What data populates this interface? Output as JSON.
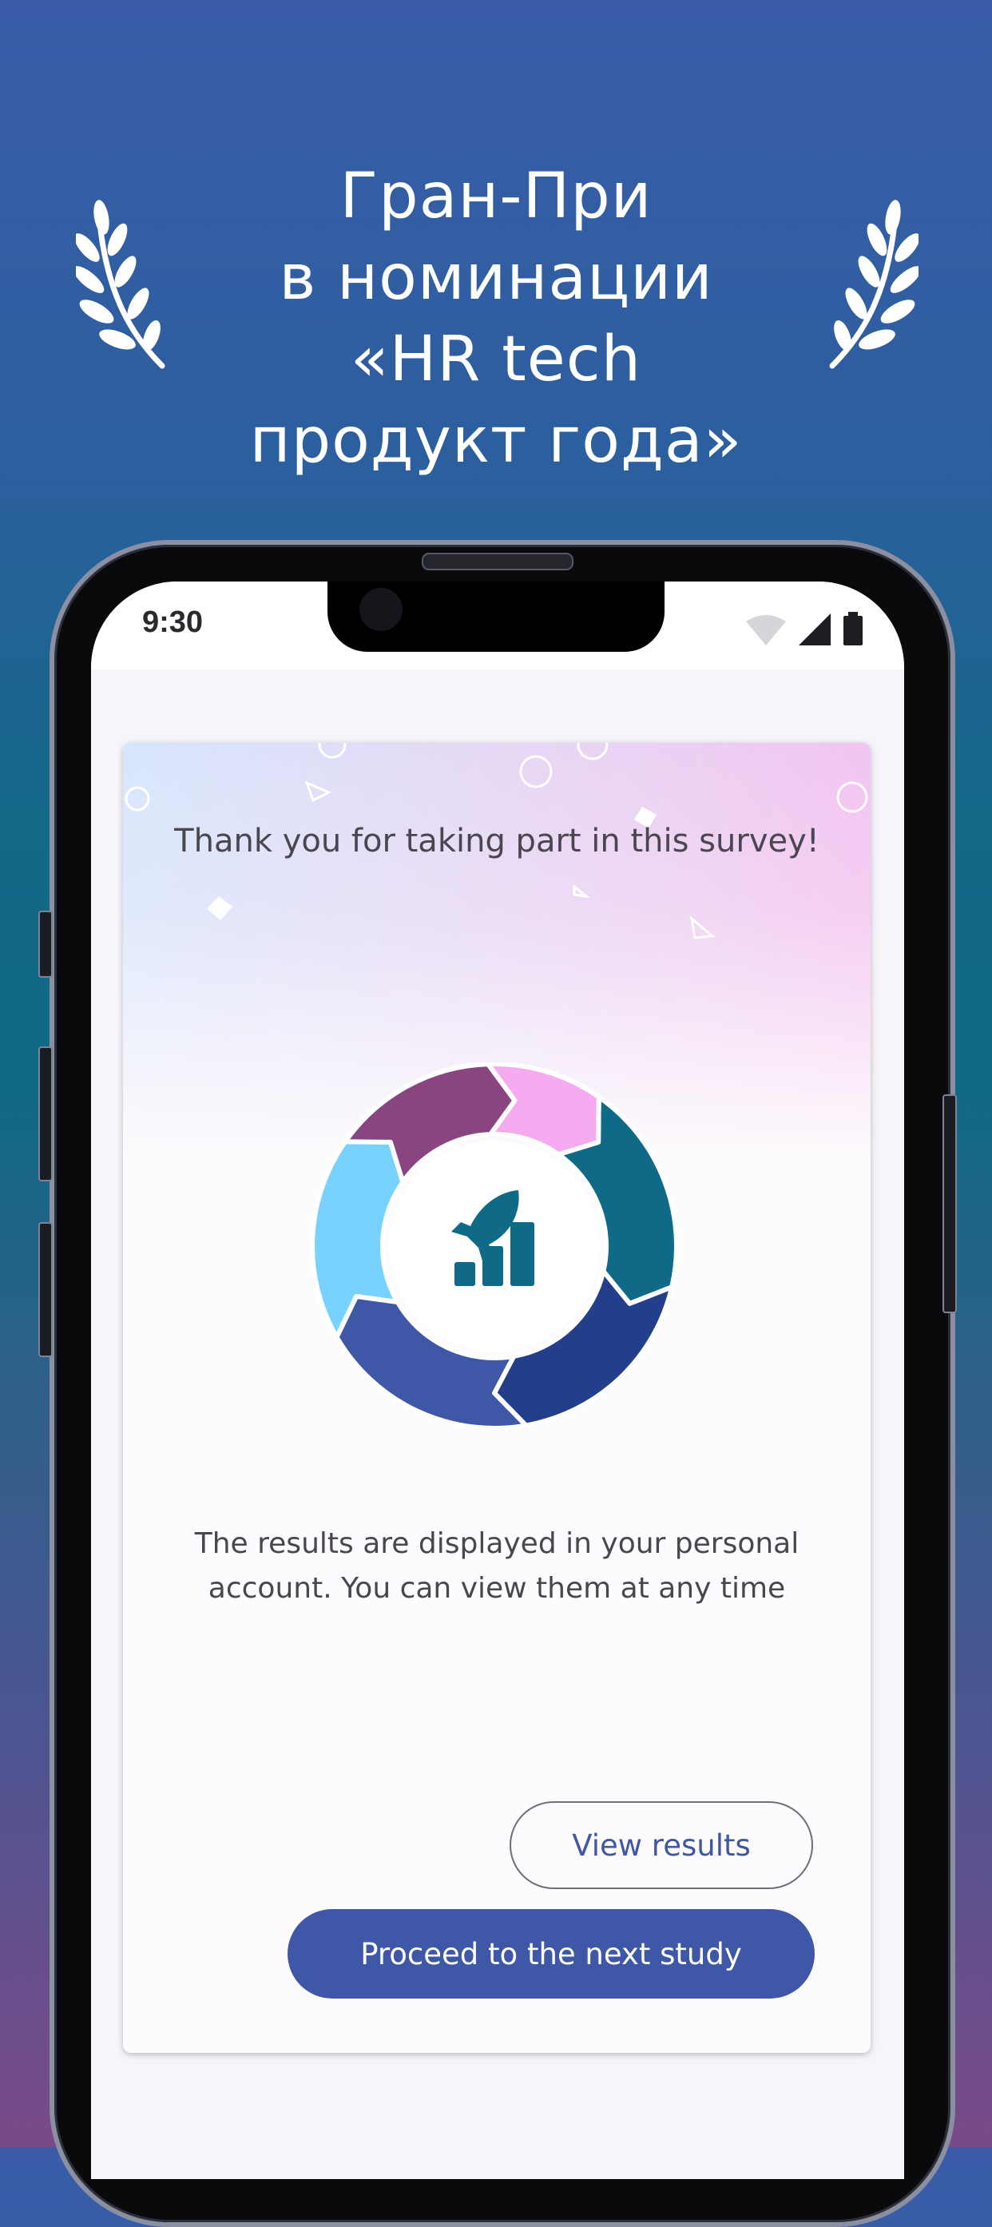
{
  "promo": {
    "headline_lines": [
      "Гран-При",
      "в номинации",
      "«HR tech",
      "продукт года»"
    ]
  },
  "status_bar": {
    "time": "9:30",
    "icons": [
      "wifi-icon",
      "signal-icon",
      "battery-icon"
    ]
  },
  "survey_complete": {
    "thanks_text": "Thank you for taking part in this survey!",
    "results_text": "The results are displayed in your personal account. You can view them at any time",
    "view_results_label": "View results",
    "next_study_label": "Proceed to the next study",
    "illustration": "cycle-growth-icon"
  },
  "colors": {
    "primary": "#3e57a6",
    "teal": "#0e6a86",
    "navy": "#233f8c",
    "pink": "#f6aaf0",
    "light_blue": "#78d2ff",
    "plum": "#8a4580"
  }
}
